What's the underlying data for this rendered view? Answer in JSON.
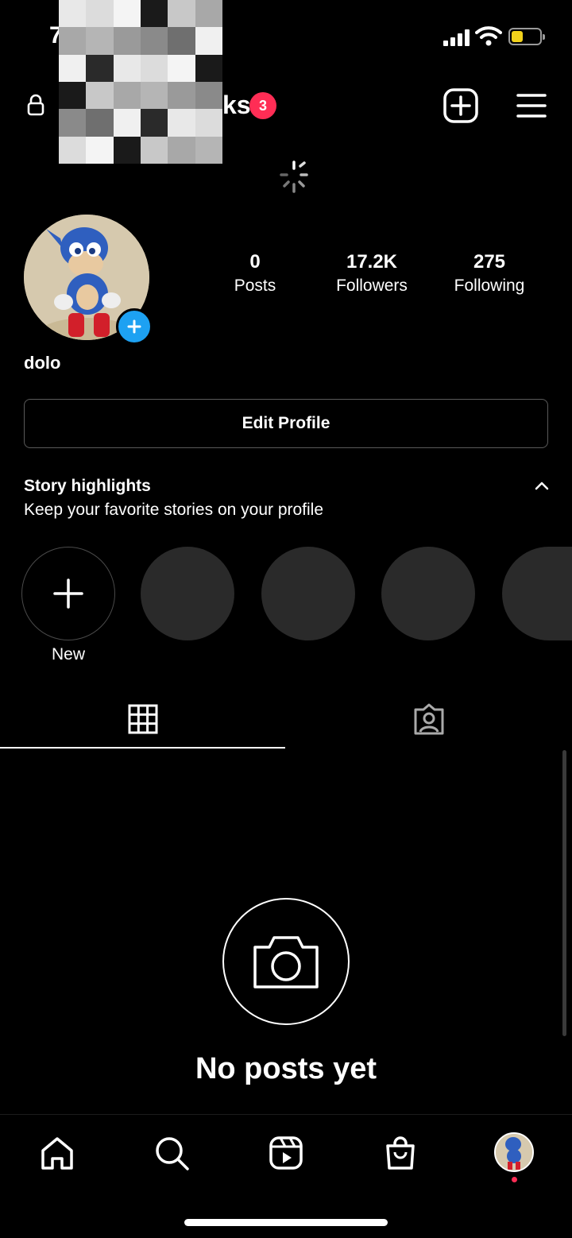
{
  "status_bar": {
    "time": "7"
  },
  "header": {
    "username_visible": "ks",
    "notification_count": "3"
  },
  "profile": {
    "posts_count": "0",
    "posts_label": "Posts",
    "followers_count": "17.2K",
    "followers_label": "Followers",
    "following_count": "275",
    "following_label": "Following",
    "display_name": "dolo"
  },
  "actions": {
    "edit_profile_label": "Edit Profile"
  },
  "highlights": {
    "title": "Story highlights",
    "subtitle": "Keep your favorite stories on your profile",
    "new_label": "New"
  },
  "empty_state": {
    "message": "No posts yet"
  },
  "tabs": [
    {
      "name": "posts-grid",
      "icon": "grid-icon",
      "active": true
    },
    {
      "name": "tagged",
      "icon": "tagged-person-icon",
      "active": false
    }
  ],
  "bottom_nav": [
    {
      "icon": "home-icon"
    },
    {
      "icon": "search-icon"
    },
    {
      "icon": "reels-icon"
    },
    {
      "icon": "shop-icon"
    },
    {
      "icon": "profile-avatar"
    }
  ],
  "colors": {
    "badge": "#ff2d55",
    "accent_blue": "#1da1f2",
    "battery_fill": "#f2d21b",
    "placeholder": "#2a2a2a"
  }
}
